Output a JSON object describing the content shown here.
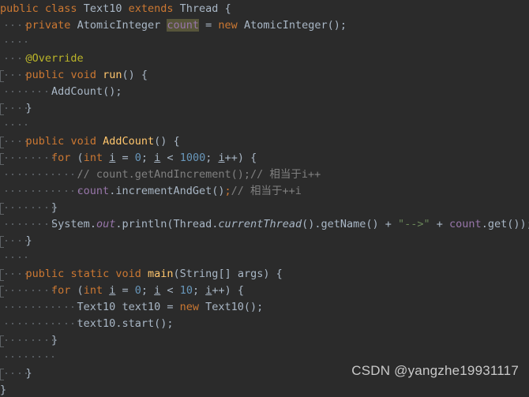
{
  "editor": {
    "theme_name": "Darcula",
    "language": "Java",
    "background": "#2b2b2b",
    "default_text_color": "#a9b7c6",
    "keyword_color": "#cc7832",
    "string_color": "#6a8759",
    "number_color": "#6897bb",
    "comment_color": "#808080",
    "annotation_color": "#bbb529",
    "method_decl_color": "#ffc66d",
    "field_color": "#9876aa",
    "caret_highlight_color": "#57553a",
    "indent_guide_color": "#555a5e",
    "char_width": 8.43,
    "line_height": 21,
    "tab_size": 4
  },
  "watermark": {
    "text": "CSDN @yangzhe19931117",
    "color": "#c9c9c9"
  },
  "code": {
    "full_text": "public class Text10 extends Thread {\n    private AtomicInteger count = new AtomicInteger();\n\n    @Override\n    public void run() {\n        AddCount();\n    }\n\n    public void AddCount() {\n        for (int i = 0; i < 1000; i++) {\n            // count.getAndIncrement();// 相当于i++\n            count.incrementAndGet();// 相当于++i\n        }\n        System.out.println(Thread.currentThread().getName() + \"-->\" + count.get());\n    }\n\n    public static void main(String[] args) {\n        for (int i = 0; i < 10; i++) {\n            Text10 text10 = new Text10();\n            text10.start();\n        }\n\n    }\n}",
    "lines": [
      {
        "n": 1,
        "indent": 0,
        "fold": false,
        "guides": [],
        "tokens": [
          {
            "t": "public",
            "c": "kw"
          },
          {
            "t": " ",
            "c": "plain"
          },
          {
            "t": "class",
            "c": "kw"
          },
          {
            "t": " ",
            "c": "plain"
          },
          {
            "t": "Text10",
            "c": "type"
          },
          {
            "t": " ",
            "c": "plain"
          },
          {
            "t": "extends",
            "c": "kw"
          },
          {
            "t": " ",
            "c": "plain"
          },
          {
            "t": "Thread",
            "c": "type"
          },
          {
            "t": " {",
            "c": "brace"
          }
        ]
      },
      {
        "n": 2,
        "indent": 4,
        "fold": false,
        "guides": [
          0
        ],
        "tokens": [
          {
            "t": "    ",
            "c": "plain"
          },
          {
            "t": "private",
            "c": "kw"
          },
          {
            "t": " ",
            "c": "plain"
          },
          {
            "t": "AtomicInteger",
            "c": "type"
          },
          {
            "t": " ",
            "c": "plain"
          },
          {
            "t": "count",
            "c": "field hl"
          },
          {
            "t": " = ",
            "c": "plain"
          },
          {
            "t": "new",
            "c": "kw"
          },
          {
            "t": " ",
            "c": "plain"
          },
          {
            "t": "AtomicInteger",
            "c": "type"
          },
          {
            "t": "();",
            "c": "plain"
          }
        ]
      },
      {
        "n": 3,
        "indent": 0,
        "fold": false,
        "guides": [
          0
        ],
        "tokens": []
      },
      {
        "n": 4,
        "indent": 4,
        "fold": false,
        "guides": [
          0
        ],
        "tokens": [
          {
            "t": "    ",
            "c": "plain"
          },
          {
            "t": "@Override",
            "c": "anno"
          }
        ]
      },
      {
        "n": 5,
        "indent": 4,
        "fold": true,
        "guides": [
          0
        ],
        "tokens": [
          {
            "t": "    ",
            "c": "plain"
          },
          {
            "t": "public",
            "c": "kw"
          },
          {
            "t": " ",
            "c": "plain"
          },
          {
            "t": "void",
            "c": "kw"
          },
          {
            "t": " ",
            "c": "plain"
          },
          {
            "t": "run",
            "c": "method"
          },
          {
            "t": "() {",
            "c": "plain"
          }
        ]
      },
      {
        "n": 6,
        "indent": 8,
        "fold": false,
        "guides": [
          0,
          1
        ],
        "tokens": [
          {
            "t": "        ",
            "c": "plain"
          },
          {
            "t": "AddCount",
            "c": "plain"
          },
          {
            "t": "();",
            "c": "plain"
          }
        ]
      },
      {
        "n": 7,
        "indent": 4,
        "fold": true,
        "guides": [
          0
        ],
        "tokens": [
          {
            "t": "    ",
            "c": "plain"
          },
          {
            "t": "}",
            "c": "brace"
          }
        ]
      },
      {
        "n": 8,
        "indent": 0,
        "fold": false,
        "guides": [
          0
        ],
        "tokens": []
      },
      {
        "n": 9,
        "indent": 4,
        "fold": true,
        "guides": [
          0
        ],
        "tokens": [
          {
            "t": "    ",
            "c": "plain"
          },
          {
            "t": "public",
            "c": "kw"
          },
          {
            "t": " ",
            "c": "plain"
          },
          {
            "t": "void",
            "c": "kw"
          },
          {
            "t": " ",
            "c": "plain"
          },
          {
            "t": "AddCount",
            "c": "method"
          },
          {
            "t": "() {",
            "c": "plain"
          }
        ]
      },
      {
        "n": 10,
        "indent": 8,
        "fold": true,
        "guides": [
          0,
          1
        ],
        "tokens": [
          {
            "t": "        ",
            "c": "plain"
          },
          {
            "t": "for",
            "c": "kw"
          },
          {
            "t": " (",
            "c": "plain"
          },
          {
            "t": "int",
            "c": "kw"
          },
          {
            "t": " ",
            "c": "plain"
          },
          {
            "t": "i",
            "c": "localv"
          },
          {
            "t": " = ",
            "c": "plain"
          },
          {
            "t": "0",
            "c": "num"
          },
          {
            "t": "; ",
            "c": "plain"
          },
          {
            "t": "i",
            "c": "localv"
          },
          {
            "t": " < ",
            "c": "plain"
          },
          {
            "t": "1000",
            "c": "num"
          },
          {
            "t": "; ",
            "c": "plain"
          },
          {
            "t": "i",
            "c": "localv"
          },
          {
            "t": "++) {",
            "c": "plain"
          }
        ]
      },
      {
        "n": 11,
        "indent": 12,
        "fold": false,
        "guides": [
          0,
          1,
          2
        ],
        "tokens": [
          {
            "t": "            ",
            "c": "plain"
          },
          {
            "t": "// count.getAndIncrement();// 相当于i++",
            "c": "cmt"
          }
        ]
      },
      {
        "n": 12,
        "indent": 12,
        "fold": false,
        "guides": [
          0,
          1,
          2
        ],
        "tokens": [
          {
            "t": "            ",
            "c": "plain"
          },
          {
            "t": "count",
            "c": "field"
          },
          {
            "t": ".incrementAndGet()",
            "c": "plain"
          },
          {
            "t": ";",
            "c": "kw"
          },
          {
            "t": "// 相当于++i",
            "c": "cmt"
          }
        ]
      },
      {
        "n": 13,
        "indent": 8,
        "fold": true,
        "guides": [
          0,
          1
        ],
        "tokens": [
          {
            "t": "        ",
            "c": "plain"
          },
          {
            "t": "}",
            "c": "brace"
          }
        ]
      },
      {
        "n": 14,
        "indent": 8,
        "fold": false,
        "guides": [
          0,
          1
        ],
        "tokens": [
          {
            "t": "        ",
            "c": "plain"
          },
          {
            "t": "System",
            "c": "plain"
          },
          {
            "t": ".",
            "c": "plain"
          },
          {
            "t": "out",
            "c": "statfld"
          },
          {
            "t": ".println(",
            "c": "plain"
          },
          {
            "t": "Thread",
            "c": "plain"
          },
          {
            "t": ".",
            "c": "plain"
          },
          {
            "t": "currentThread",
            "c": "statmth"
          },
          {
            "t": "().getName() + ",
            "c": "plain"
          },
          {
            "t": "\"-->\"",
            "c": "str"
          },
          {
            "t": " + ",
            "c": "plain"
          },
          {
            "t": "count",
            "c": "field"
          },
          {
            "t": ".get());",
            "c": "plain"
          }
        ]
      },
      {
        "n": 15,
        "indent": 4,
        "fold": true,
        "guides": [
          0
        ],
        "tokens": [
          {
            "t": "    ",
            "c": "plain"
          },
          {
            "t": "}",
            "c": "brace"
          }
        ]
      },
      {
        "n": 16,
        "indent": 0,
        "fold": false,
        "guides": [
          0
        ],
        "tokens": []
      },
      {
        "n": 17,
        "indent": 4,
        "fold": true,
        "guides": [
          0
        ],
        "tokens": [
          {
            "t": "    ",
            "c": "plain"
          },
          {
            "t": "public",
            "c": "kw"
          },
          {
            "t": " ",
            "c": "plain"
          },
          {
            "t": "static",
            "c": "kw"
          },
          {
            "t": " ",
            "c": "plain"
          },
          {
            "t": "void",
            "c": "kw"
          },
          {
            "t": " ",
            "c": "plain"
          },
          {
            "t": "main",
            "c": "method"
          },
          {
            "t": "(",
            "c": "plain"
          },
          {
            "t": "String",
            "c": "type"
          },
          {
            "t": "[] args) {",
            "c": "plain"
          }
        ]
      },
      {
        "n": 18,
        "indent": 8,
        "fold": true,
        "guides": [
          0,
          1
        ],
        "tokens": [
          {
            "t": "        ",
            "c": "plain"
          },
          {
            "t": "for",
            "c": "kw"
          },
          {
            "t": " (",
            "c": "plain"
          },
          {
            "t": "int",
            "c": "kw"
          },
          {
            "t": " ",
            "c": "plain"
          },
          {
            "t": "i",
            "c": "localv"
          },
          {
            "t": " = ",
            "c": "plain"
          },
          {
            "t": "0",
            "c": "num"
          },
          {
            "t": "; ",
            "c": "plain"
          },
          {
            "t": "i",
            "c": "localv"
          },
          {
            "t": " < ",
            "c": "plain"
          },
          {
            "t": "10",
            "c": "num"
          },
          {
            "t": "; ",
            "c": "plain"
          },
          {
            "t": "i",
            "c": "localv"
          },
          {
            "t": "++) {",
            "c": "plain"
          }
        ]
      },
      {
        "n": 19,
        "indent": 12,
        "fold": false,
        "guides": [
          0,
          1,
          2
        ],
        "tokens": [
          {
            "t": "            ",
            "c": "plain"
          },
          {
            "t": "Text10",
            "c": "type"
          },
          {
            "t": " text10 = ",
            "c": "plain"
          },
          {
            "t": "new",
            "c": "kw"
          },
          {
            "t": " ",
            "c": "plain"
          },
          {
            "t": "Text10",
            "c": "type"
          },
          {
            "t": "();",
            "c": "plain"
          }
        ]
      },
      {
        "n": 20,
        "indent": 12,
        "fold": false,
        "guides": [
          0,
          1,
          2
        ],
        "tokens": [
          {
            "t": "            ",
            "c": "plain"
          },
          {
            "t": "text10.start();",
            "c": "plain"
          }
        ]
      },
      {
        "n": 21,
        "indent": 8,
        "fold": true,
        "guides": [
          0,
          1
        ],
        "tokens": [
          {
            "t": "        ",
            "c": "plain"
          },
          {
            "t": "}",
            "c": "brace"
          }
        ]
      },
      {
        "n": 22,
        "indent": 0,
        "fold": false,
        "guides": [
          0,
          1
        ],
        "tokens": []
      },
      {
        "n": 23,
        "indent": 4,
        "fold": true,
        "guides": [
          0
        ],
        "tokens": [
          {
            "t": "    ",
            "c": "plain"
          },
          {
            "t": "}",
            "c": "brace"
          }
        ]
      },
      {
        "n": 24,
        "indent": 0,
        "fold": false,
        "guides": [],
        "tokens": [
          {
            "t": "}",
            "c": "brace"
          }
        ]
      }
    ]
  }
}
